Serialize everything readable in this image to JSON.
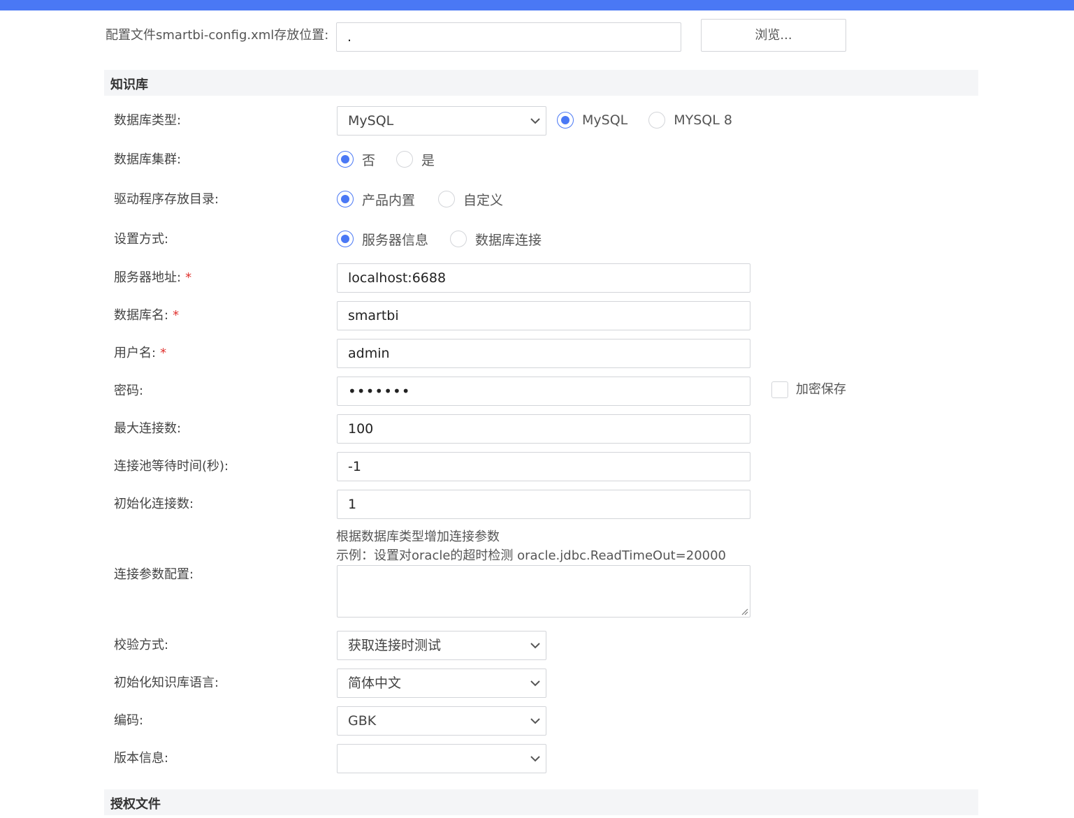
{
  "config_path": {
    "label": "配置文件smartbi-config.xml存放位置:",
    "value": ".",
    "browse_label": "浏览..."
  },
  "sections": {
    "knowledge_base": "知识库",
    "license_file": "授权文件"
  },
  "db_type": {
    "label": "数据库类型:",
    "selected": "MySQL",
    "options": [
      "MySQL",
      "MYSQL 8"
    ],
    "checked": "MySQL"
  },
  "db_cluster": {
    "label": "数据库集群:",
    "options": [
      "否",
      "是"
    ],
    "checked": "否"
  },
  "driver_dir": {
    "label": "驱动程序存放目录:",
    "options": [
      "产品内置",
      "自定义"
    ],
    "checked": "产品内置"
  },
  "setup_mode": {
    "label": "设置方式:",
    "options": [
      "服务器信息",
      "数据库连接"
    ],
    "checked": "服务器信息"
  },
  "required_mark": "*",
  "server_address": {
    "label": "服务器地址:",
    "value": "localhost:6688"
  },
  "db_name": {
    "label": "数据库名:",
    "value": "smartbi"
  },
  "username": {
    "label": "用户名:",
    "value": "admin"
  },
  "password": {
    "label": "密码:",
    "value": "•••••••",
    "encrypt_label": "加密保存"
  },
  "max_connections": {
    "label": "最大连接数:",
    "value": "100"
  },
  "pool_wait": {
    "label": "连接池等待时间(秒):",
    "value": "-1"
  },
  "init_connections": {
    "label": "初始化连接数:",
    "value": "1"
  },
  "conn_params": {
    "label": "连接参数配置:",
    "hint1": "根据数据库类型增加连接参数",
    "hint2": "示例：设置对oracle的超时检测 oracle.jdbc.ReadTimeOut=20000",
    "value": ""
  },
  "validation": {
    "label": "校验方式:",
    "selected": "获取连接时测试"
  },
  "kb_language": {
    "label": "初始化知识库语言:",
    "selected": "简体中文"
  },
  "encoding": {
    "label": "编码:",
    "selected": "GBK"
  },
  "version": {
    "label": "版本信息:",
    "selected": ""
  },
  "colors": {
    "accent": "#4a78f5",
    "border": "#d3d5d9",
    "section_bg": "#f4f5f7",
    "required": "#e0332f"
  }
}
